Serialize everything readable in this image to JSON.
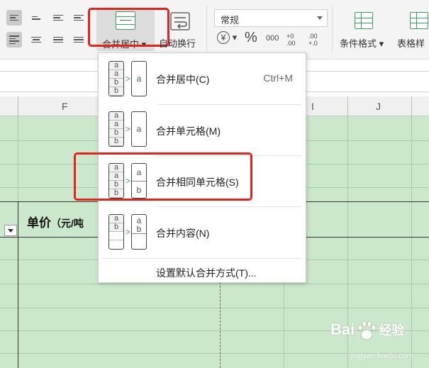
{
  "ribbon": {
    "merge_center_label": "合并居中",
    "wrap_text_label": "自动换行",
    "number_format_value": "常规",
    "percent_symbol": "%",
    "thousands_label": "000",
    "increase_decimal_label": "+0 .00",
    "decrease_decimal_label": ".00 +.0",
    "conditional_format_label": "条件格式",
    "table_style_label": "表格样"
  },
  "sheet": {
    "columns": [
      "F",
      "I",
      "J"
    ],
    "header_cell": "单价",
    "header_cell_unit": "（元/吨"
  },
  "merge_menu": {
    "items": [
      {
        "label": "合并居中(C)",
        "shortcut": "Ctrl+M"
      },
      {
        "label": "合并单元格(M)",
        "shortcut": ""
      },
      {
        "label": "合并相同单元格(S)",
        "shortcut": ""
      },
      {
        "label": "合并内容(N)",
        "shortcut": ""
      }
    ],
    "default_setting_label": "设置默认合并方式(T)..."
  },
  "watermark": {
    "brand": "Bai",
    "brand_tail": "经验",
    "url": "jingyan.baidu.com"
  },
  "colors": {
    "highlight_red": "#e5221c",
    "sheet_green": "#cbe8cc",
    "accent_green": "#39a35a"
  }
}
